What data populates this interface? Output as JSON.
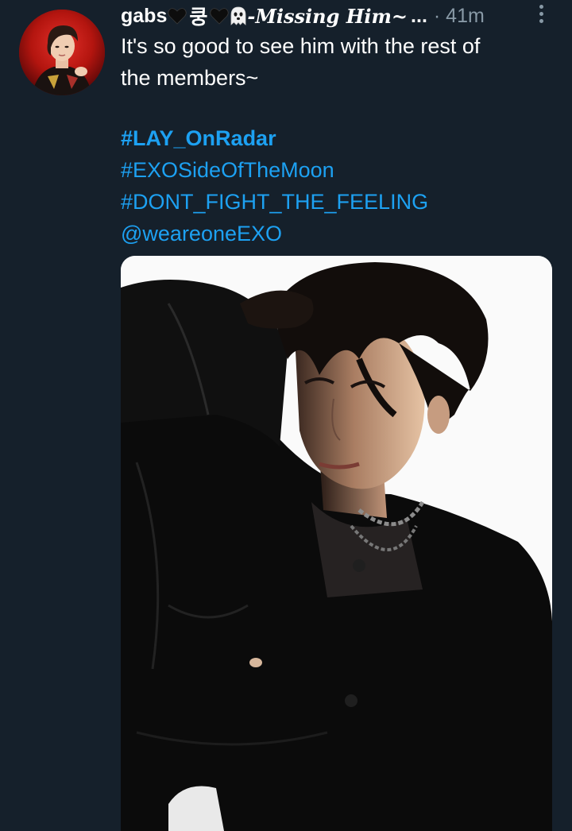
{
  "tweet": {
    "author": {
      "display_name_start": "gabs",
      "korean_char": "쿵",
      "display_name_fancy": "-Missing Him~",
      "truncation": "...",
      "timestamp": "· 41m"
    },
    "text_lines": [
      "It's so good to see him with the rest of",
      "the members~"
    ],
    "hashtags": [
      "#LAY_OnRadar",
      "#EXOSideOfTheMoon",
      "#DONT_FIGHT_THE_FEELING"
    ],
    "mention": "@weareoneEXO"
  },
  "colors": {
    "background": "#15202b",
    "link": "#1da1f2",
    "secondary_text": "#8899a6",
    "primary_text": "#ffffff"
  },
  "icons": {
    "heart": "black-heart-icon",
    "ghost": "ghost-icon",
    "more": "more-vertical-icon"
  }
}
